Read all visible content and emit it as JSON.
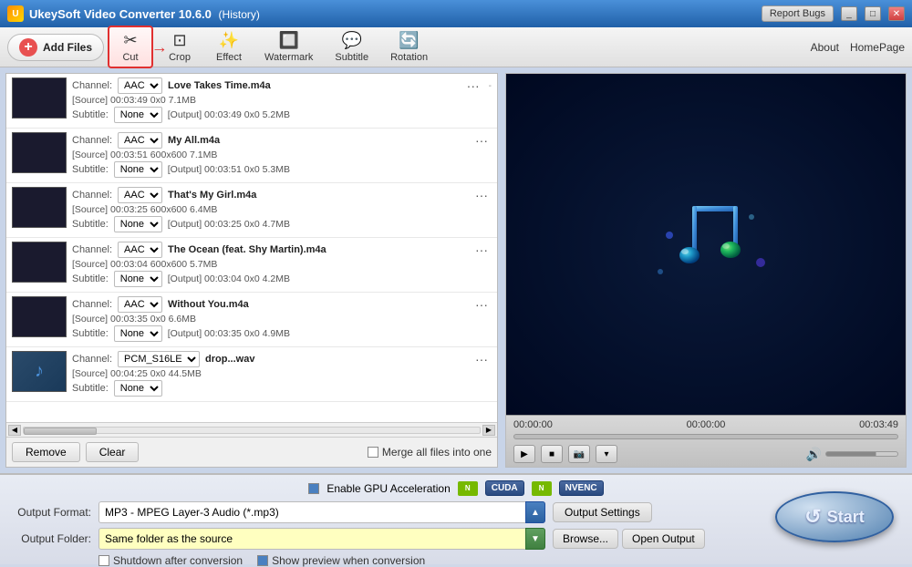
{
  "app": {
    "title": "UkeySoft Video Converter 10.6.0",
    "history_label": "(History)",
    "report_bugs": "Report Bugs",
    "about": "About",
    "homepage": "HomePage"
  },
  "toolbar": {
    "add_files": "Add Files",
    "cut": "Cut",
    "crop": "Crop",
    "effect": "Effect",
    "watermark": "Watermark",
    "subtitle": "Subtitle",
    "rotation": "Rotation"
  },
  "files": [
    {
      "thumb_type": "dark",
      "channel": "AAC",
      "subtitle": "None",
      "name": "Love Takes Time.m4a",
      "source": "[Source] 00:03:49  0x0    7.1MB",
      "output": "[Output]  00:03:49  0x0    5.2MB",
      "dash": "-"
    },
    {
      "thumb_type": "dark",
      "channel": "AAC",
      "subtitle": "None",
      "name": "My All.m4a",
      "source": "[Source] 00:03:51  600x600  7.1MB",
      "output": "[Output]  00:03:51  0x0    5.3MB",
      "dash": ""
    },
    {
      "thumb_type": "dark",
      "channel": "AAC",
      "subtitle": "None",
      "name": "That's My Girl.m4a",
      "source": "[Source] 00:03:25  600x600  6.4MB",
      "output": "[Output]  00:03:25  0x0    4.7MB",
      "dash": ""
    },
    {
      "thumb_type": "dark",
      "channel": "AAC",
      "subtitle": "None",
      "name": "The Ocean (feat. Shy Martin).m4a",
      "source": "[Source] 00:03:04  600x600  5.7MB",
      "output": "[Output]  00:03:04  0x0    4.2MB",
      "dash": ""
    },
    {
      "thumb_type": "dark",
      "channel": "AAC",
      "subtitle": "None",
      "name": "Without You.m4a",
      "source": "[Source] 00:03:35  0x0    6.6MB",
      "output": "[Output]  00:03:35  0x0    4.9MB",
      "dash": ""
    },
    {
      "thumb_type": "image",
      "channel": "PCM_S16LE",
      "subtitle": "",
      "name": "drop...wav",
      "source": "[Source] 00:04:25  0x0    44.5MB",
      "output": "",
      "dash": ""
    }
  ],
  "preview": {
    "time_start": "00:00:00",
    "time_mid": "00:00:00",
    "time_end": "00:03:49"
  },
  "bottom": {
    "gpu_label": "Enable GPU Acceleration",
    "cuda": "CUDA",
    "nvenc": "NVENC",
    "format_label": "Output Format:",
    "format_value": "MP3 - MPEG Layer-3 Audio (*.mp3)",
    "output_settings": "Output Settings",
    "folder_label": "Output Folder:",
    "folder_value": "Same folder as the source",
    "browse": "Browse...",
    "open_output": "Open Output",
    "shutdown": "Shutdown after conversion",
    "show_preview": "Show preview when conversion",
    "start": "Start",
    "remove": "Remove",
    "clear": "Clear",
    "merge": "Merge all files into one"
  }
}
